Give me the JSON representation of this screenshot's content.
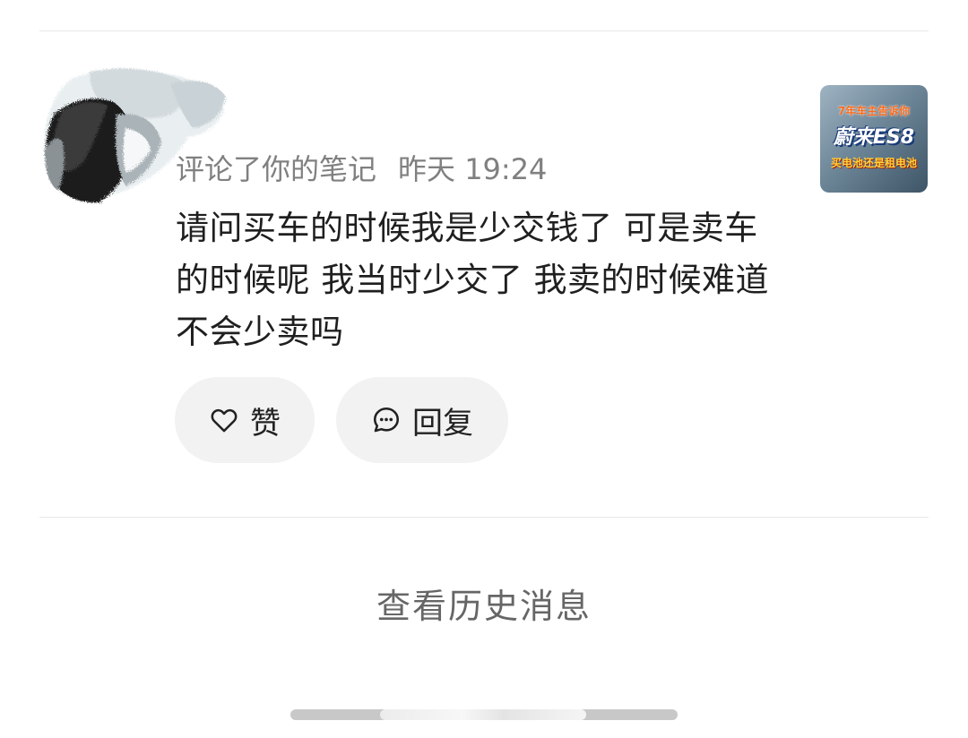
{
  "notification": {
    "action_text": "评论了你的笔记",
    "time": "昨天 19:24",
    "comment": "请问买车的时候我是少交钱了 可是卖车的时候呢 我当时少交了 我卖的时候难道不会少卖吗",
    "thumbnail": {
      "line1": "7年车主告诉你",
      "line2": "蔚来ES8",
      "line3": "买电池还是租电池"
    },
    "like_label": "赞",
    "reply_label": "回复"
  },
  "footer": {
    "history_label": "查看历史消息"
  },
  "icons": {
    "like": "heart-icon",
    "reply": "chat-bubble-icon"
  },
  "colors": {
    "text_primary": "#1f1f1f",
    "text_secondary": "#808080",
    "pill_background": "#f2f2f2",
    "divider": "#e8e8e8"
  }
}
